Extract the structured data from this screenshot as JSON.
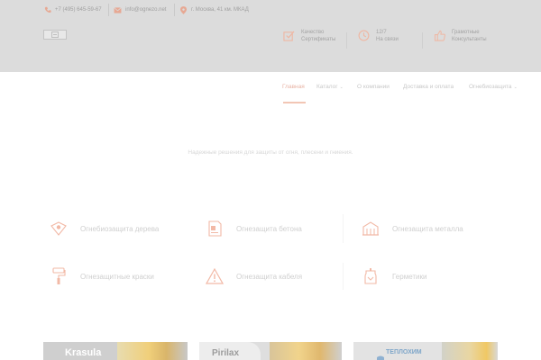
{
  "topbar": {
    "phone": "+7 (495) 645-59-67",
    "email": "info@ognezo.net",
    "address": "г. Москва, 41 км. МКАД"
  },
  "header": {
    "features": [
      {
        "line1": "Качество",
        "line2": "Сертификаты",
        "icon": "checkbox-icon"
      },
      {
        "line1": "12/7",
        "line2": "На связи",
        "icon": "clock-icon"
      },
      {
        "line1": "Грамотные",
        "line2": "Консультанты",
        "icon": "thumbs-up-icon"
      }
    ]
  },
  "nav": {
    "items": [
      {
        "label": "Главная",
        "active": true,
        "dropdown": false
      },
      {
        "label": "Каталог",
        "active": false,
        "dropdown": true
      },
      {
        "label": "О компании",
        "active": false,
        "dropdown": false
      },
      {
        "label": "Доставка и оплата",
        "active": false,
        "dropdown": false
      },
      {
        "label": "Огнебиозащита",
        "active": false,
        "dropdown": true
      }
    ]
  },
  "tagline": "Надежные решения для защиты от огня, плесени и гниения.",
  "categories": [
    {
      "label": "Огнебиозащита дерева",
      "icon": "shield-wood-icon"
    },
    {
      "label": "Огнезащита бетона",
      "icon": "concrete-icon"
    },
    {
      "label": "Огнезащита металла",
      "icon": "metal-structure-icon"
    },
    {
      "label": "Огнезащитные краски",
      "icon": "paint-roller-icon"
    },
    {
      "label": "Огнезащита кабеля",
      "icon": "warning-cable-icon"
    },
    {
      "label": "Герметики",
      "icon": "sealant-icon"
    }
  ],
  "brands": [
    {
      "name": "Krasula"
    },
    {
      "name": "Pirilax"
    },
    {
      "name": "ТЕПЛОХИМ"
    }
  ],
  "colors": {
    "accent": "#e8b3a4",
    "header_bg": "#dcdcdc",
    "icon_orange": "#f2b9a6"
  }
}
